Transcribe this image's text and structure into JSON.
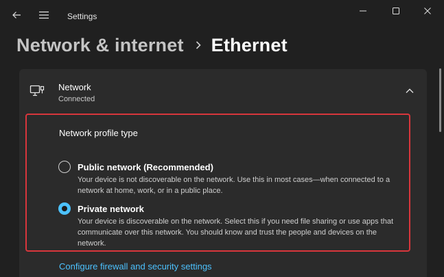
{
  "window": {
    "title": "Settings",
    "icons": {
      "back": "back-arrow-icon",
      "menu": "hamburger-menu-icon",
      "minimize": "minimize-icon",
      "maximize": "maximize-icon",
      "close": "close-icon"
    }
  },
  "breadcrumb": {
    "parent": "Network & internet",
    "separator_icon": "chevron-right-icon",
    "current": "Ethernet"
  },
  "network_card": {
    "icon": "ethernet-icon",
    "title": "Network",
    "status": "Connected",
    "expanded": true,
    "chevron_icon": "chevron-up-icon"
  },
  "profile": {
    "title": "Network profile type",
    "options": [
      {
        "label": "Public network (Recommended)",
        "description": "Your device is not discoverable on the network. Use this in most cases—when connected to a network at home, work, or in a public place.",
        "selected": false
      },
      {
        "label": "Private network",
        "description": "Your device is discoverable on the network. Select this if you need file sharing or use apps that communicate over this network. You should know and trust the people and devices on the network.",
        "selected": true
      }
    ]
  },
  "links": {
    "firewall": "Configure firewall and security settings"
  },
  "colors": {
    "background": "#202020",
    "card": "#2b2b2b",
    "accent": "#4cc2ff",
    "highlight_border": "#d9363c"
  }
}
